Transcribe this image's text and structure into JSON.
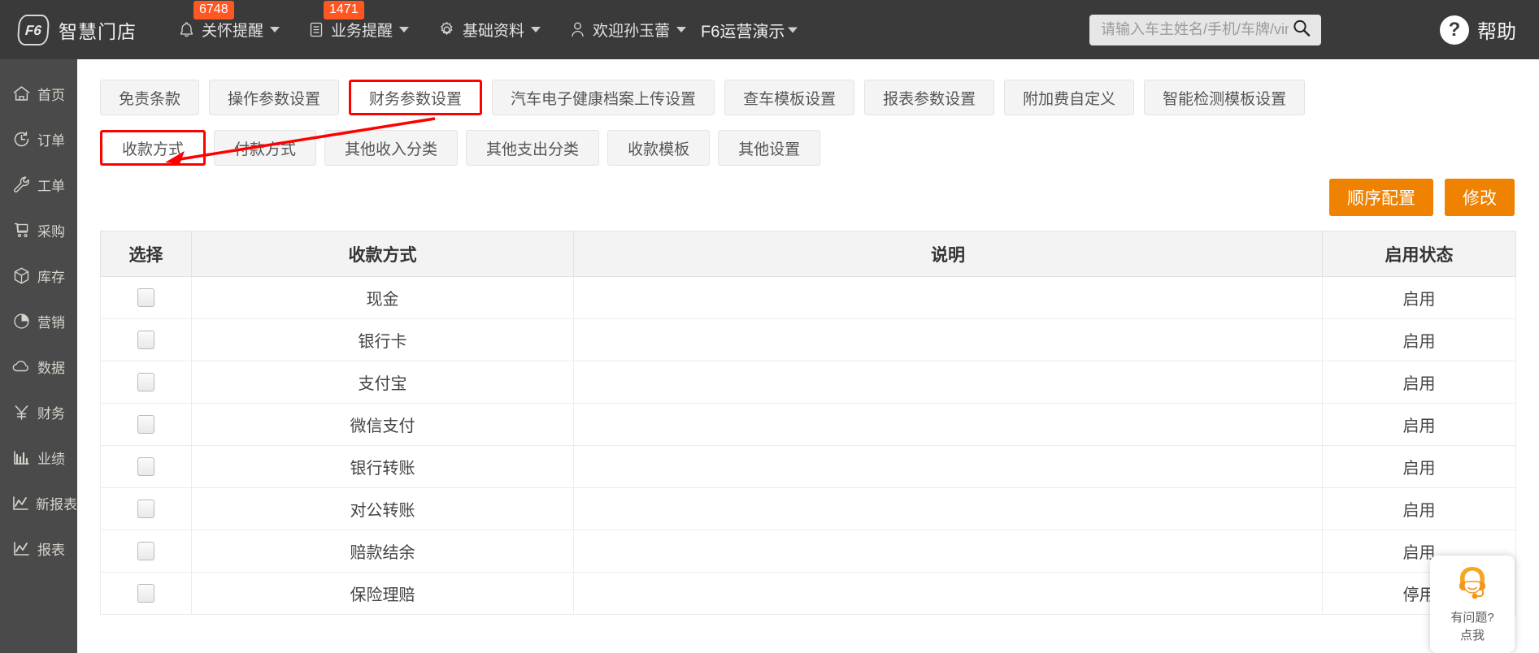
{
  "header": {
    "brand_logo_text": "F6",
    "brand_name": "智慧门店",
    "nav": [
      {
        "label": "关怀提醒",
        "badge": "6748",
        "icon": "bell-icon"
      },
      {
        "label": "业务提醒",
        "badge": "1471",
        "icon": "document-icon"
      },
      {
        "label": "基础资料",
        "badge": "",
        "icon": "gear-icon"
      },
      {
        "label": "欢迎孙玉蕾",
        "badge": "",
        "icon": "user-icon"
      }
    ],
    "tenant": "F6运营演示",
    "search_placeholder": "请输入车主姓名/手机/车牌/vin码",
    "search_value": "",
    "help_mark": "?",
    "help_label": "帮助"
  },
  "sidebar": {
    "items": [
      {
        "label": "首页",
        "icon": "home-icon"
      },
      {
        "label": "订单",
        "icon": "clock-icon"
      },
      {
        "label": "工单",
        "icon": "wrench-icon"
      },
      {
        "label": "采购",
        "icon": "cart-icon"
      },
      {
        "label": "库存",
        "icon": "box-icon"
      },
      {
        "label": "营销",
        "icon": "pie-icon"
      },
      {
        "label": "数据",
        "icon": "cloud-icon"
      },
      {
        "label": "财务",
        "icon": "yuan-icon"
      },
      {
        "label": "业绩",
        "icon": "bar-chart-icon"
      },
      {
        "label": "新报表",
        "icon": "line-chart-icon"
      },
      {
        "label": "报表",
        "icon": "line-chart-icon"
      }
    ]
  },
  "main": {
    "tabs": [
      {
        "label": "免责条款",
        "active": false
      },
      {
        "label": "操作参数设置",
        "active": false
      },
      {
        "label": "财务参数设置",
        "active": true
      },
      {
        "label": "汽车电子健康档案上传设置",
        "active": false
      },
      {
        "label": "查车模板设置",
        "active": false
      },
      {
        "label": "报表参数设置",
        "active": false
      },
      {
        "label": "附加费自定义",
        "active": false
      },
      {
        "label": "智能检测模板设置",
        "active": false
      }
    ],
    "subtabs": [
      {
        "label": "收款方式",
        "active": true
      },
      {
        "label": "付款方式",
        "active": false
      },
      {
        "label": "其他收入分类",
        "active": false
      },
      {
        "label": "其他支出分类",
        "active": false
      },
      {
        "label": "收款模板",
        "active": false
      },
      {
        "label": "其他设置",
        "active": false
      }
    ],
    "buttons": [
      {
        "label": "顺序配置"
      },
      {
        "label": "修改"
      }
    ],
    "table": {
      "columns": [
        "选择",
        "收款方式",
        "说明",
        "启用状态"
      ],
      "rows": [
        {
          "name": "现金",
          "desc": "",
          "state": "启用"
        },
        {
          "name": "银行卡",
          "desc": "",
          "state": "启用"
        },
        {
          "name": "支付宝",
          "desc": "",
          "state": "启用"
        },
        {
          "name": "微信支付",
          "desc": "",
          "state": "启用"
        },
        {
          "name": "银行转账",
          "desc": "",
          "state": "启用"
        },
        {
          "name": "对公转账",
          "desc": "",
          "state": "启用"
        },
        {
          "name": "赔款结余",
          "desc": "",
          "state": "启用"
        },
        {
          "name": "保险理赔",
          "desc": "",
          "state": "停用"
        }
      ]
    }
  },
  "chat_widget": {
    "line1": "有问题?",
    "line2": "点我",
    "icon": "headset-support-icon"
  },
  "colors": {
    "topbar_bg": "#3a3a3a",
    "sidebar_bg": "#4a4a4a",
    "accent_orange": "#ef8200",
    "badge_red": "#ff5722",
    "highlight_red": "#ff0000"
  }
}
